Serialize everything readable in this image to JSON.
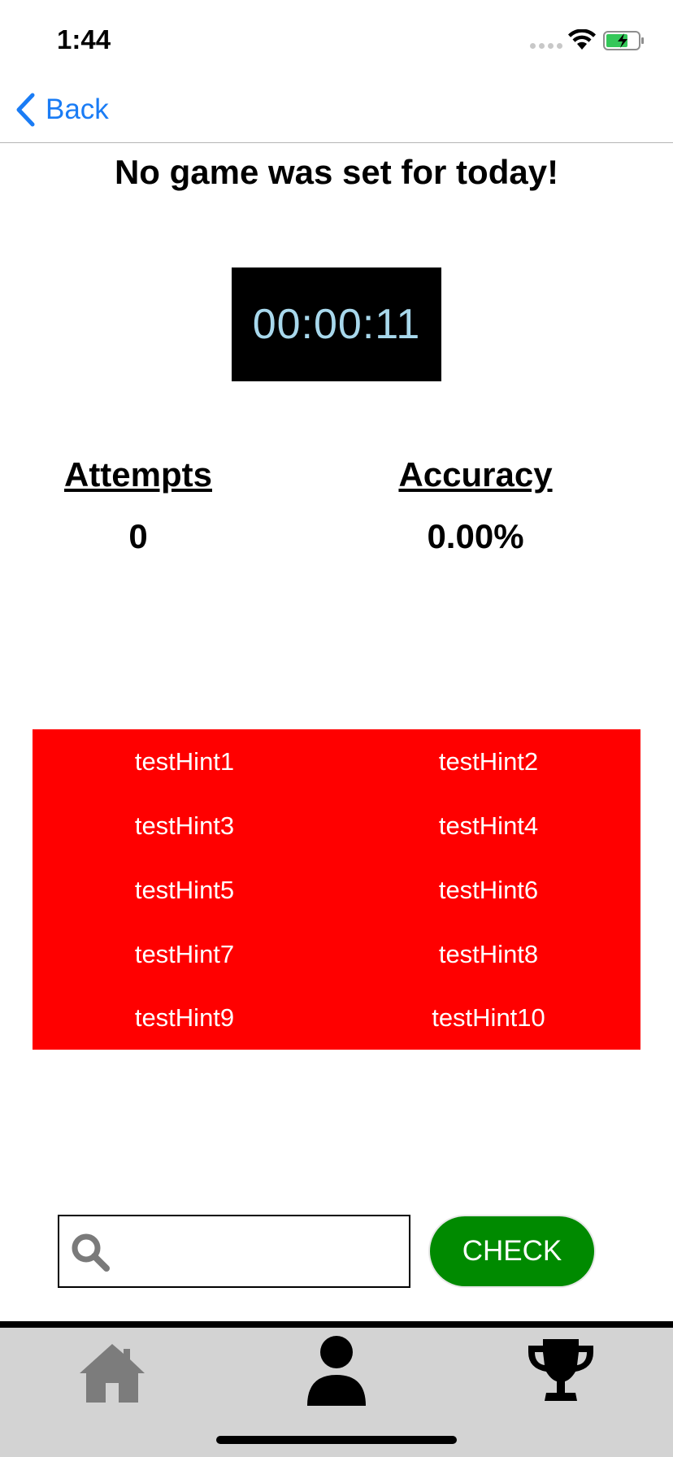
{
  "status_bar": {
    "time": "1:44"
  },
  "nav": {
    "back_label": "Back"
  },
  "game": {
    "title": "No game was set for today!",
    "timer": "00:00:11"
  },
  "stats": {
    "attempts_label": "Attempts",
    "attempts_value": "0",
    "accuracy_label": "Accuracy",
    "accuracy_value": "0.00%"
  },
  "hints": [
    "testHint1",
    "testHint2",
    "testHint3",
    "testHint4",
    "testHint5",
    "testHint6",
    "testHint7",
    "testHint8",
    "testHint9",
    "testHint10"
  ],
  "search": {
    "value": "",
    "placeholder": ""
  },
  "check_button": {
    "label": "CHECK"
  },
  "tabs": [
    {
      "icon": "home-icon"
    },
    {
      "icon": "profile-icon"
    },
    {
      "icon": "trophy-icon"
    }
  ],
  "colors": {
    "hint_background": "#ff0000",
    "check_button": "#008a00",
    "back_link": "#1a7cf5",
    "timer_text": "#a8d8ec",
    "tab_bar": "#d3d3d3"
  }
}
